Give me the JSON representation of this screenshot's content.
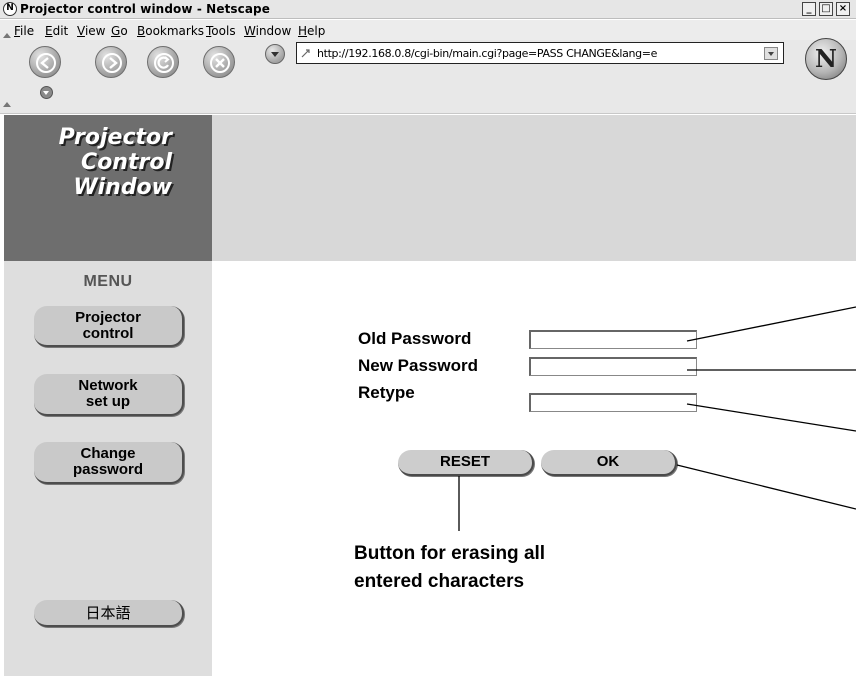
{
  "window": {
    "title": "Projector control window - Netscape",
    "controls": {
      "minimize": "_",
      "maximize": "□",
      "close": "×"
    }
  },
  "menubar": {
    "items": [
      "File",
      "Edit",
      "View",
      "Go",
      "Bookmarks",
      "Tools",
      "Window",
      "Help"
    ]
  },
  "toolbar": {
    "back_icon": "back-arrow-icon",
    "forward_icon": "forward-arrow-icon",
    "reload_icon": "reload-icon",
    "stop_icon": "stop-icon",
    "url": "http://192.168.0.8/cgi-bin/main.cgi?page=PASS CHANGE&lang=e",
    "brand_glyph": "N"
  },
  "logo": {
    "lines": [
      "Projector",
      "Control",
      "Window"
    ]
  },
  "sidebar": {
    "heading": "MENU",
    "items": [
      {
        "label_line1": "Projector",
        "label_line2": "control"
      },
      {
        "label_line1": "Network",
        "label_line2": "set up"
      },
      {
        "label_line1": "Change",
        "label_line2": "password"
      },
      {
        "label_line1": "日本語",
        "label_line2": ""
      }
    ]
  },
  "form": {
    "old_password_label": "Old Password",
    "new_password_label": "New Password",
    "retype_label": "Retype",
    "old_password_value": "",
    "new_password_value": "",
    "retype_value": "",
    "reset_label": "RESET",
    "ok_label": "OK"
  },
  "annotation": {
    "reset_callout_line1": "Button for erasing all",
    "reset_callout_line2": "entered characters"
  },
  "colors": {
    "logo_panel": "#6e6e6e",
    "sidebar_bg": "#dedede",
    "header_band": "#d8d8d8",
    "button_face": "#cdcdcd"
  }
}
